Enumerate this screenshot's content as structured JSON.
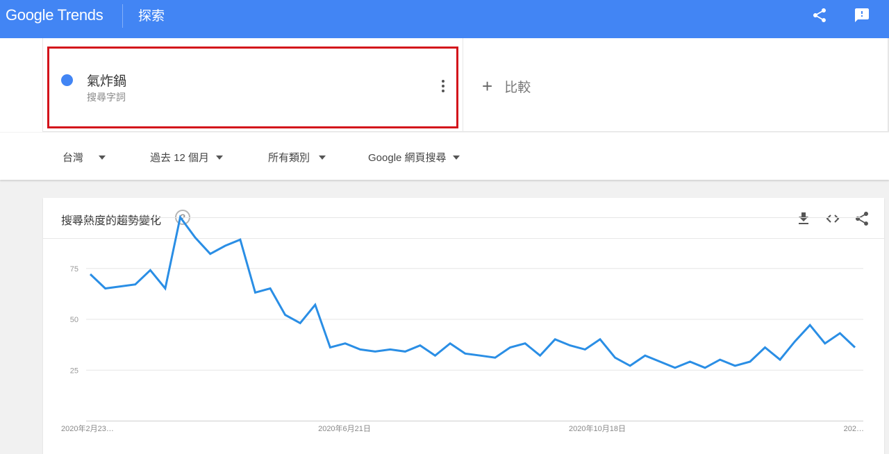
{
  "header": {
    "logo_google": "Google",
    "logo_trends": "Trends",
    "explore_label": "探索",
    "icons": [
      "share-icon",
      "feedback-icon"
    ]
  },
  "term": {
    "name": "氣炸鍋",
    "type": "搜尋字詞",
    "color": "#4285f4",
    "highlight_color": "#d3131b"
  },
  "compare_label": "比較",
  "filters": {
    "region": "台灣",
    "time": "過去 12 個月",
    "category": "所有類別",
    "property": "Google 網頁搜尋"
  },
  "card": {
    "title": "搜尋熱度的趨勢變化",
    "help_symbol": "?",
    "icons": [
      "download-icon",
      "embed-icon",
      "share-icon"
    ]
  },
  "chart_data": {
    "type": "line",
    "title": "搜尋熱度的趨勢變化",
    "xlabel": "",
    "ylabel": "",
    "ylim": [
      0,
      100
    ],
    "yticks": [
      "100",
      "75",
      "50",
      "25"
    ],
    "xtick_labels": [
      "2020年2月23…",
      "2020年6月21日",
      "2020年10月18日",
      "202…"
    ],
    "grid": true,
    "series": [
      {
        "name": "氣炸鍋",
        "color": "#2a8ee5",
        "values": [
          72,
          65,
          66,
          67,
          74,
          65,
          100,
          90,
          82,
          86,
          89,
          63,
          65,
          52,
          48,
          57,
          36,
          38,
          35,
          34,
          35,
          34,
          37,
          32,
          38,
          33,
          32,
          31,
          36,
          38,
          32,
          40,
          37,
          35,
          40,
          31,
          27,
          32,
          29,
          26,
          29,
          26,
          30,
          27,
          29,
          36,
          30,
          39,
          47,
          38,
          43,
          36
        ]
      }
    ]
  }
}
